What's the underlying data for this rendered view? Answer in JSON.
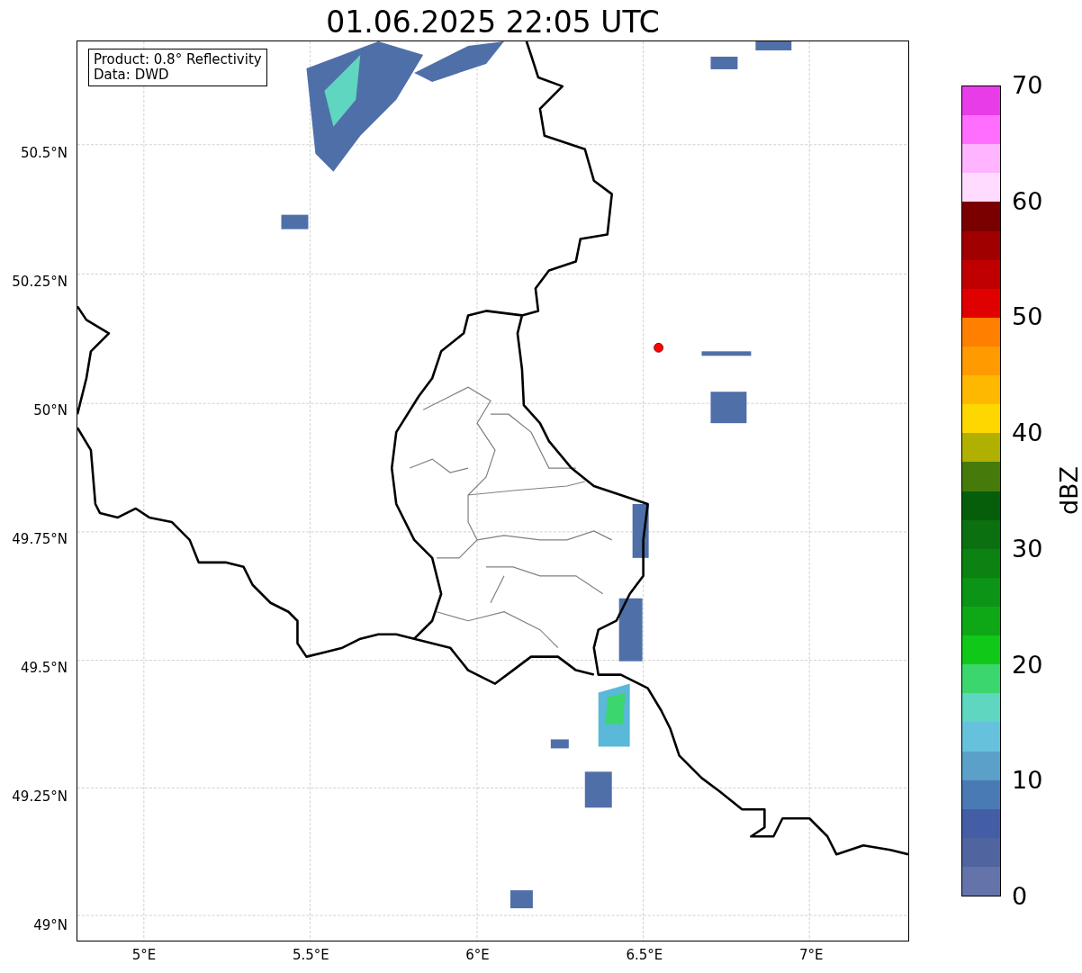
{
  "title": "01.06.2025 22:05 UTC",
  "info_box": [
    "Product: 0.8° Reflectivity",
    "Data: DWD"
  ],
  "map": {
    "y_ticks": [
      "50.5°N",
      "50.25°N",
      "50°N",
      "49.75°N",
      "49.5°N",
      "49.25°N",
      "49°N"
    ],
    "x_ticks": [
      "5°E",
      "5.5°E",
      "6°E",
      "6.5°E",
      "7°E"
    ]
  },
  "colorbar": {
    "label": "dBZ",
    "ticks": [
      "70",
      "60",
      "50",
      "40",
      "30",
      "20",
      "10",
      "0"
    ],
    "segments": [
      {
        "color": "#e83ce8"
      },
      {
        "color": "#ff6eff"
      },
      {
        "color": "#ffb4ff"
      },
      {
        "color": "#ffdcff"
      },
      {
        "color": "#7a0000"
      },
      {
        "color": "#a00000"
      },
      {
        "color": "#c00000"
      },
      {
        "color": "#e00000"
      },
      {
        "color": "#ff7f00"
      },
      {
        "color": "#ff9a00"
      },
      {
        "color": "#ffb800"
      },
      {
        "color": "#ffd700"
      },
      {
        "color": "#b0b000"
      },
      {
        "color": "#467a0a"
      },
      {
        "color": "#065e0a"
      },
      {
        "color": "#0a7010"
      },
      {
        "color": "#0b8212"
      },
      {
        "color": "#0b9415"
      },
      {
        "color": "#0ea817"
      },
      {
        "color": "#10c818"
      },
      {
        "color": "#3cd66e"
      },
      {
        "color": "#5ed6c0"
      },
      {
        "color": "#66c2dc"
      },
      {
        "color": "#5aa0c8"
      },
      {
        "color": "#4a7ab4"
      },
      {
        "color": "#445ea6"
      },
      {
        "color": "#5064a0"
      },
      {
        "color": "#6474aa"
      }
    ]
  }
}
